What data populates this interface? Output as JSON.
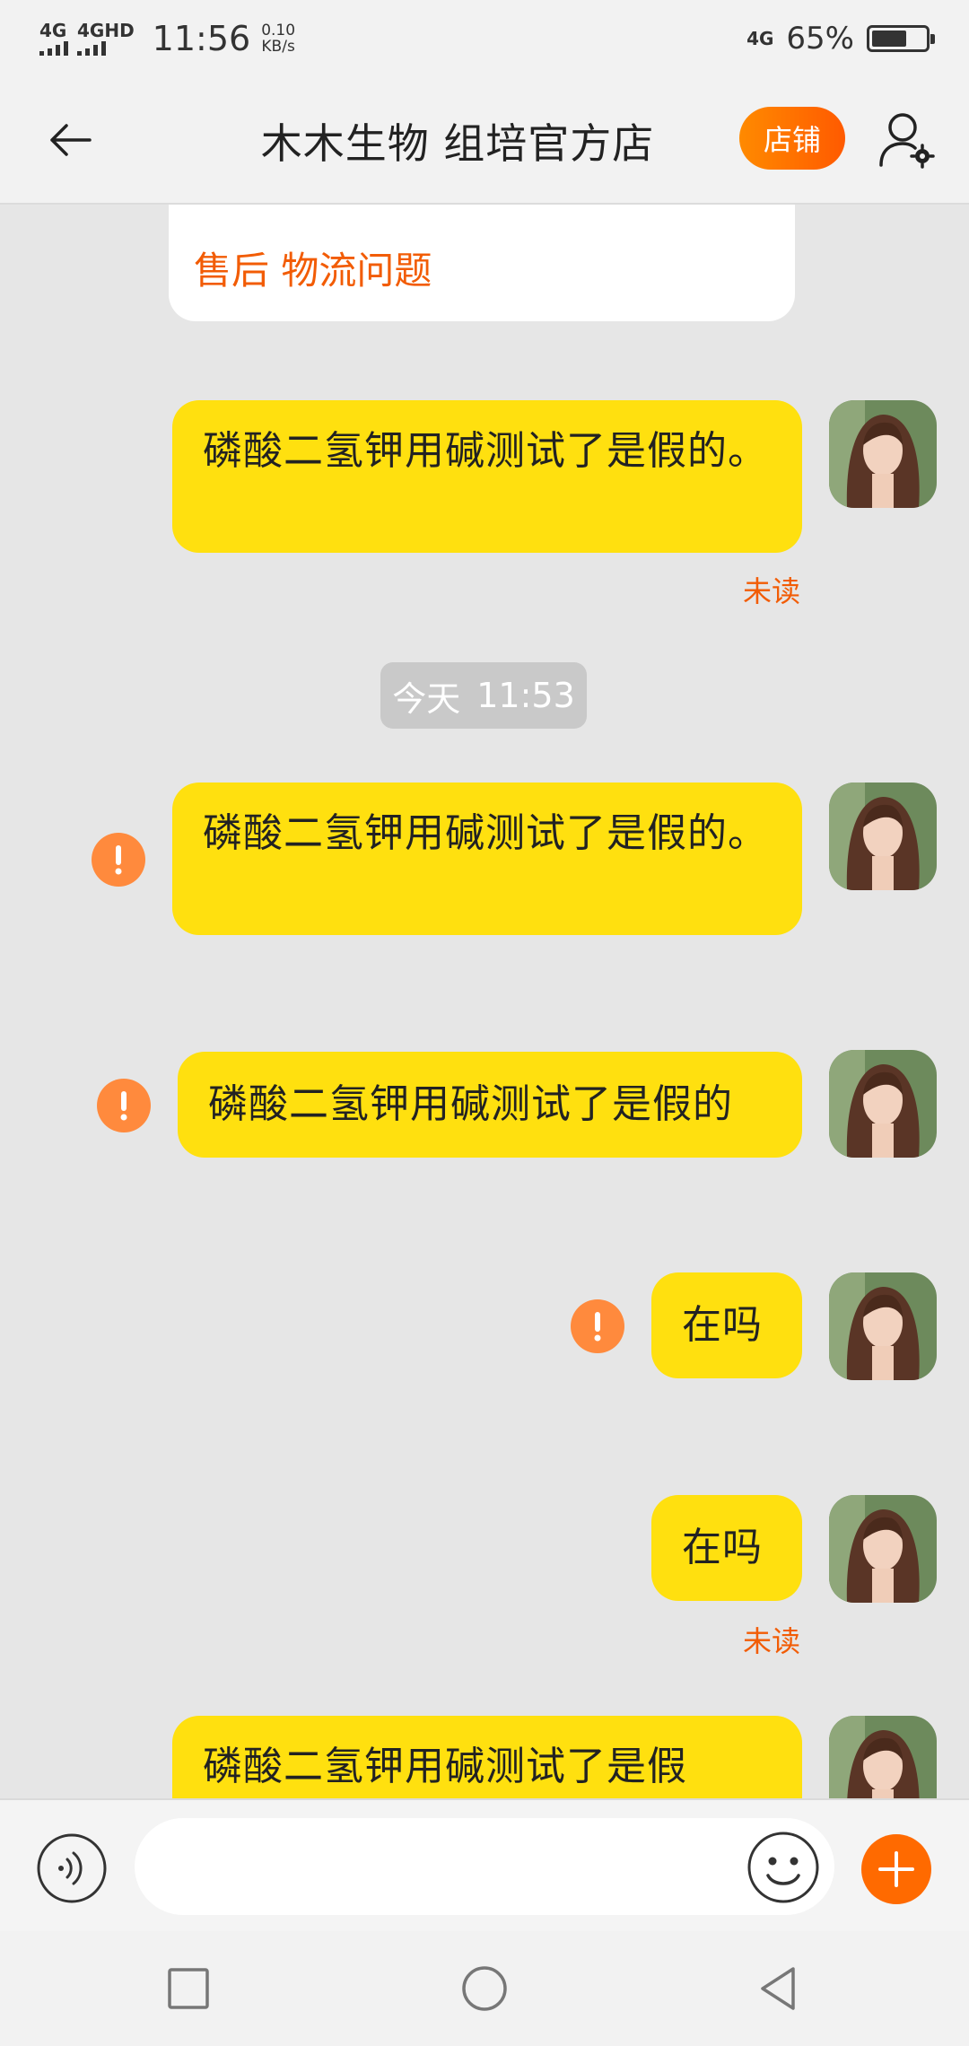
{
  "status_bar": {
    "net1": "4G",
    "net2": "4GHD",
    "time": "11:56",
    "speed_value": "0.10",
    "speed_unit": "KB/s",
    "net_right": "4G",
    "battery_percent_text": "65%",
    "battery_level": 0.65
  },
  "header": {
    "title": "木木生物 组培官方店",
    "shop_label": "店铺"
  },
  "chat": {
    "card_text": "售后 物流问题",
    "timestamp_day": "今天",
    "timestamp_time": "11:53",
    "messages": [
      {
        "text": "磷酸二氢钾用碱测试了是假的。",
        "status": "未读"
      },
      {
        "text": "磷酸二氢钾用碱测试了是假的。",
        "status": "failed"
      },
      {
        "text": "磷酸二氢钾用碱测试了是假的",
        "status": "failed"
      },
      {
        "text": "在吗",
        "status": "failed"
      },
      {
        "text": "在吗",
        "status": "未读"
      },
      {
        "text": "磷酸二氢钾用碱测试了是假",
        "status": ""
      }
    ]
  },
  "input": {
    "placeholder": "",
    "value": ""
  },
  "icons": {
    "back": "arrow-left-icon",
    "user_settings": "user-gear-icon",
    "voice": "voice-icon",
    "emoji": "smiley-icon",
    "plus": "plus-icon",
    "failed": "exclamation-icon",
    "nav_recents": "square-icon",
    "nav_home": "circle-icon",
    "nav_back": "triangle-back-icon"
  },
  "colors": {
    "accent_orange": "#ff6a00",
    "bubble_yellow": "#ffe00f",
    "unread_orange": "#f25c05",
    "alert_orange": "#ff8a3d"
  }
}
